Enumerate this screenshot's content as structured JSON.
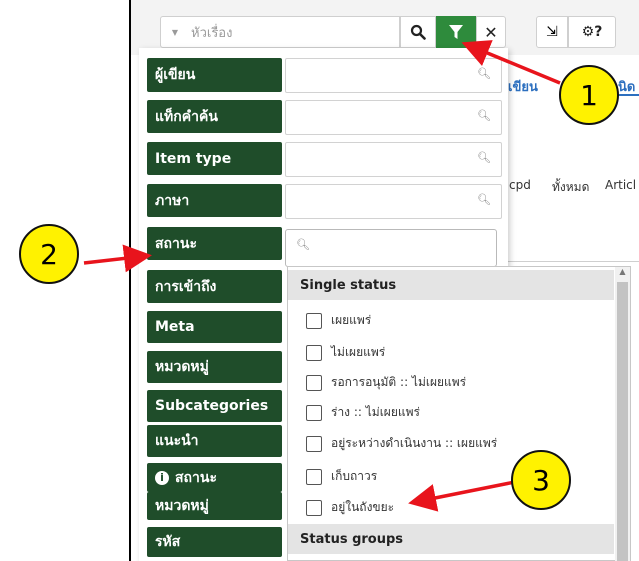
{
  "toolbar": {
    "search_placeholder": "หัวเรื่อง",
    "clear_label": "✕",
    "fullscreen_label": "⇲",
    "settings_label": "⚙?"
  },
  "background": {
    "tab_author_partial": "เขียน",
    "tab_type_partial": "นิด",
    "col_cpd": "cpd",
    "col_all": "ทั้งหมด",
    "col_article": "Articl"
  },
  "filters": [
    {
      "label": "ผู้เขียน"
    },
    {
      "label": "แท็กคำค้น"
    },
    {
      "label": "Item type"
    },
    {
      "label": "ภาษา"
    },
    {
      "label": "สถานะ"
    },
    {
      "label": "การเข้าถึง"
    },
    {
      "label": "Meta"
    },
    {
      "label": "หมวดหมู่"
    },
    {
      "label": "Subcategories"
    },
    {
      "label": "แนะนำ"
    },
    {
      "label": "สถานะ"
    },
    {
      "label": "หมวดหมู่"
    },
    {
      "label": "รหัส"
    }
  ],
  "status_dropdown": {
    "group_single": "Single status",
    "options": [
      "เผยแพร่",
      "ไม่เผยแพร่",
      "รอการอนุมัติ :: ไม่เผยแพร่",
      "ร่าง :: ไม่เผยแพร่",
      "อยู่ระหว่างดำเนินงาน :: เผยแพร่",
      "เก็บถาวร",
      "อยู่ในถังขยะ"
    ],
    "group_status_groups": "Status groups"
  },
  "callouts": [
    "1",
    "2",
    "3"
  ],
  "colors": {
    "filter_label_bg": "#1f4d2a",
    "filter_button_bg": "#2e8b3c",
    "callout_fill": "#fff200",
    "arrow": "#e8141c"
  }
}
